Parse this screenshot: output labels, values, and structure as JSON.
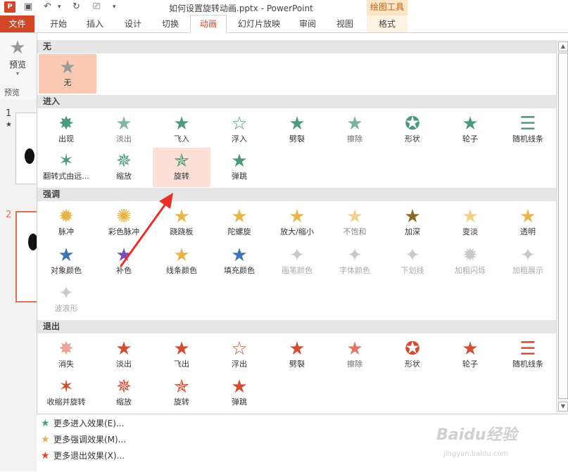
{
  "app": {
    "title": "如何设置旋转动画.pptx - PowerPoint",
    "logo": "P",
    "context_group": "绘图工具"
  },
  "tabs": [
    {
      "label": "文件"
    },
    {
      "label": "开始"
    },
    {
      "label": "插入"
    },
    {
      "label": "设计"
    },
    {
      "label": "切换"
    },
    {
      "label": "动画"
    },
    {
      "label": "幻灯片放映"
    },
    {
      "label": "审阅"
    },
    {
      "label": "视图"
    },
    {
      "label": "格式"
    }
  ],
  "ribbon": {
    "preview_label": "预览",
    "group_label": "预览"
  },
  "slides": [
    {
      "number": "1",
      "marker": "★"
    },
    {
      "number": "2"
    }
  ],
  "sections": {
    "none": "无",
    "entrance": "进入",
    "emphasis": "强调",
    "exit": "退出"
  },
  "none_effects": [
    {
      "label": "无"
    }
  ],
  "entrance_effects": [
    {
      "label": "出现"
    },
    {
      "label": "淡出"
    },
    {
      "label": "飞入"
    },
    {
      "label": "浮入"
    },
    {
      "label": "劈裂"
    },
    {
      "label": "擦除"
    },
    {
      "label": "形状"
    },
    {
      "label": "轮子"
    },
    {
      "label": "随机线条"
    },
    {
      "label": "翻转式由远..."
    },
    {
      "label": "缩放"
    },
    {
      "label": "旋转"
    },
    {
      "label": "弹跳"
    }
  ],
  "emphasis_effects": [
    {
      "label": "脉冲"
    },
    {
      "label": "彩色脉冲"
    },
    {
      "label": "跷跷板"
    },
    {
      "label": "陀螺旋"
    },
    {
      "label": "放大/缩小"
    },
    {
      "label": "不饱和"
    },
    {
      "label": "加深"
    },
    {
      "label": "变淡"
    },
    {
      "label": "透明"
    },
    {
      "label": "对象颜色"
    },
    {
      "label": "补色"
    },
    {
      "label": "线条颜色"
    },
    {
      "label": "填充颜色"
    },
    {
      "label": "画笔颜色"
    },
    {
      "label": "字体颜色"
    },
    {
      "label": "下划线"
    },
    {
      "label": "加粗闪烁"
    },
    {
      "label": "加粗展示"
    },
    {
      "label": "波浪形"
    }
  ],
  "exit_effects": [
    {
      "label": "消失"
    },
    {
      "label": "淡出"
    },
    {
      "label": "飞出"
    },
    {
      "label": "浮出"
    },
    {
      "label": "劈裂"
    },
    {
      "label": "擦除"
    },
    {
      "label": "形状"
    },
    {
      "label": "轮子"
    },
    {
      "label": "随机线条"
    },
    {
      "label": "收缩并旋转"
    },
    {
      "label": "缩放"
    },
    {
      "label": "旋转"
    },
    {
      "label": "弹跳"
    }
  ],
  "more_menu": [
    {
      "label": "更多进入效果(E)...",
      "color": "#4f9a7a"
    },
    {
      "label": "更多强调效果(M)...",
      "color": "#e7b54b"
    },
    {
      "label": "更多退出效果(X)...",
      "color": "#d24d34"
    }
  ],
  "watermark": {
    "text": "Baidu经验",
    "sub": "jingyan.baidu.com"
  },
  "colors": {
    "accent": "#d24726",
    "entrance": "#4f9a7a",
    "emphasis": "#e7b54b",
    "exit": "#d24d34",
    "annotation": "#e8302a"
  }
}
